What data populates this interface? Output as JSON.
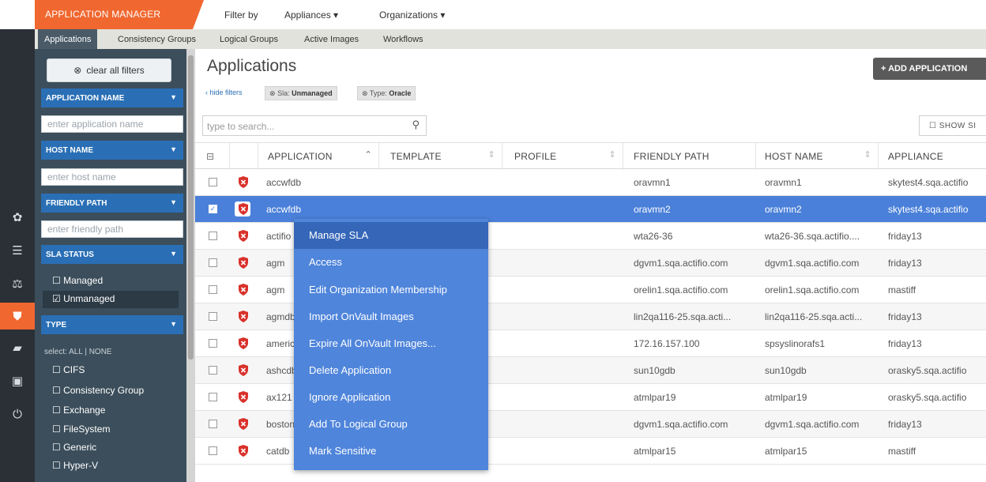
{
  "header": {
    "app_title": "APPLICATION MANAGER",
    "filter_by": "Filter by",
    "appliances": "Appliances ▾",
    "organizations": "Organizations ▾"
  },
  "tabs": [
    {
      "label": "Applications"
    },
    {
      "label": "Consistency Groups"
    },
    {
      "label": "Logical Groups"
    },
    {
      "label": "Active Images"
    },
    {
      "label": "Workflows"
    }
  ],
  "sidebar": {
    "clear_filters": "clear all filters",
    "app_name_head": "APPLICATION NAME",
    "app_name_placeholder": "enter application name",
    "host_name_head": "HOST NAME",
    "host_name_placeholder": "enter host name",
    "friendly_path_head": "FRIENDLY PATH",
    "friendly_path_placeholder": "enter friendly path",
    "sla_head": "SLA STATUS",
    "sla_managed": "☐ Managed",
    "sla_unmanaged": "☑ Unmanaged",
    "type_head": "TYPE",
    "type_select": "select: ALL | NONE",
    "types": [
      "☐ CIFS",
      "☐ Consistency Group",
      "☐ Exchange",
      "☐ FileSystem",
      "☐ Generic",
      "☐ Hyper-V"
    ]
  },
  "main": {
    "title": "Applications",
    "add_button": "+ ADD APPLICATION",
    "hide_filters": "‹ hide filters",
    "chip_sla_label": "Sla:",
    "chip_sla_value": "Unmanaged",
    "chip_type_label": "Type:",
    "chip_type_value": "Oracle",
    "search_placeholder": "type to search...",
    "show_button": "☐ SHOW SI"
  },
  "table": {
    "columns": [
      "APPLICATION",
      "TEMPLATE",
      "PROFILE",
      "FRIENDLY PATH",
      "HOST NAME",
      "APPLIANCE"
    ],
    "rows": [
      {
        "app": "accwfdb",
        "path": "oravmn1",
        "host": "oravmn1",
        "appliance": "skytest4.sqa.actifio"
      },
      {
        "app": "accwfdb",
        "path": "oravmn2",
        "host": "oravmn2",
        "appliance": "skytest4.sqa.actifio"
      },
      {
        "app": "actifio",
        "path": "wta26-36",
        "host": "wta26-36.sqa.actifio....",
        "appliance": "friday13"
      },
      {
        "app": "agm",
        "path": "dgvm1.sqa.actifio.com",
        "host": "dgvm1.sqa.actifio.com",
        "appliance": "friday13"
      },
      {
        "app": "agm",
        "path": "orelin1.sqa.actifio.com",
        "host": "orelin1.sqa.actifio.com",
        "appliance": "mastiff"
      },
      {
        "app": "agmdb",
        "path": "lin2qa116-25.sqa.acti...",
        "host": "lin2qa116-25.sqa.acti...",
        "appliance": "friday13"
      },
      {
        "app": "americas",
        "path": "172.16.157.100",
        "host": "spsyslinorafs1",
        "appliance": "friday13"
      },
      {
        "app": "ashcdb",
        "path": "sun10gdb",
        "host": "sun10gdb",
        "appliance": "orasky5.sqa.actifio"
      },
      {
        "app": "ax121",
        "path": "atmlpar19",
        "host": "atmlpar19",
        "appliance": "orasky5.sqa.actifio"
      },
      {
        "app": "bostondb",
        "path": "dgvm1.sqa.actifio.com",
        "host": "dgvm1.sqa.actifio.com",
        "appliance": "friday13"
      },
      {
        "app": "catdb",
        "path": "atmlpar15",
        "host": "atmlpar15",
        "appliance": "mastiff"
      }
    ]
  },
  "context_menu": [
    "Manage SLA",
    "Access",
    "Edit Organization Membership",
    "Import OnVault Images",
    "Expire All OnVault Images...",
    "Delete Application",
    "Ignore Application",
    "Add To Logical Group",
    "Mark Sensitive"
  ],
  "colors": {
    "accent": "#f0672f",
    "filter_head": "#2a6fb5",
    "selected_row": "#4a80d9",
    "menu": "#4f85db"
  }
}
